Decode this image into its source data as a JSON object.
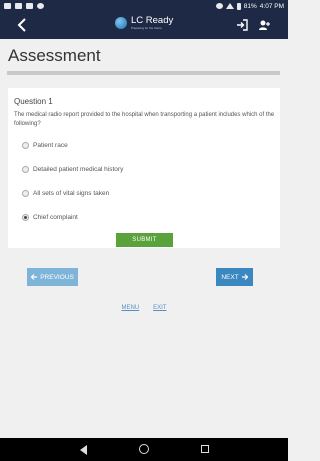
{
  "status_bar": {
    "battery": "81%",
    "time": "4:07 PM"
  },
  "header": {
    "app_title": "LC Ready",
    "app_subtitle": "Preparing for the future"
  },
  "page": {
    "title": "Assessment"
  },
  "question": {
    "heading": "Question 1",
    "text": "The medical radio report provided to the hospital when transporting a patient includes which of the following?",
    "options": [
      {
        "label": "Patient race",
        "selected": false
      },
      {
        "label": "Detailed patient medical history",
        "selected": false
      },
      {
        "label": "All sets of vital signs taken",
        "selected": false
      },
      {
        "label": "Chief complaint",
        "selected": true
      }
    ],
    "submit_label": "SUBMIT"
  },
  "navigation": {
    "previous_label": "PREVIOUS",
    "next_label": "NEXT"
  },
  "footer_links": {
    "menu": "MENU",
    "exit": "EXIT"
  },
  "colors": {
    "header_bg": "#1e2a45",
    "submit_bg": "#5aa23c",
    "prev_bg": "#7fb4d9",
    "next_bg": "#3b87c0"
  }
}
